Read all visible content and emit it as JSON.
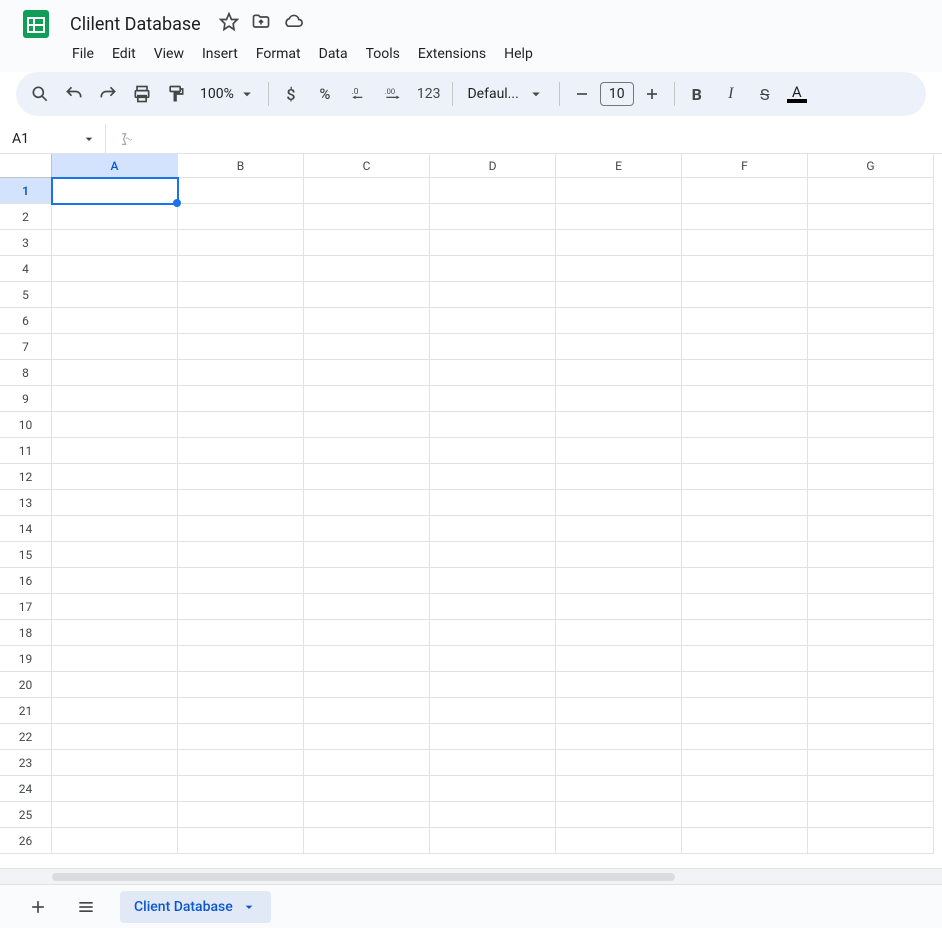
{
  "doc": {
    "title": "Clilent Database"
  },
  "menu": [
    "File",
    "Edit",
    "View",
    "Insert",
    "Format",
    "Data",
    "Tools",
    "Extensions",
    "Help"
  ],
  "toolbar": {
    "zoom": "100%",
    "number_format_123": "123",
    "font": "Defaul...",
    "font_size": "10"
  },
  "namebox": {
    "ref": "A1"
  },
  "grid": {
    "columns": [
      "A",
      "B",
      "C",
      "D",
      "E",
      "F",
      "G"
    ],
    "row_count": 26,
    "selected_cell": "A1",
    "selected_col": "A",
    "selected_row": 1
  },
  "sheets": {
    "active": "Client Database"
  }
}
